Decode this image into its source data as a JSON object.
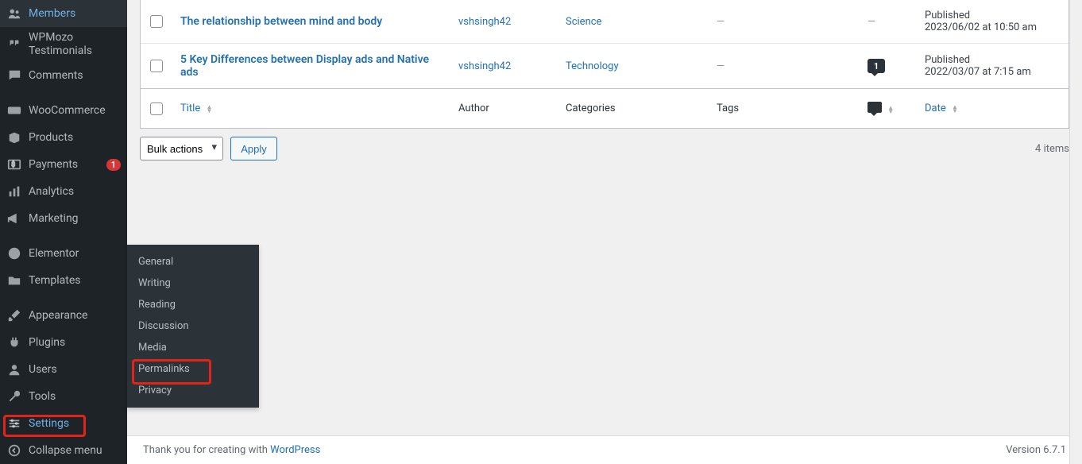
{
  "sidebar": {
    "items": [
      {
        "id": "members",
        "label": "Members"
      },
      {
        "id": "wpmozo",
        "label": "WPMozo Testimonials"
      },
      {
        "id": "comments",
        "label": "Comments"
      },
      {
        "id": "woocommerce",
        "label": "WooCommerce"
      },
      {
        "id": "products",
        "label": "Products"
      },
      {
        "id": "payments",
        "label": "Payments",
        "badge": "1"
      },
      {
        "id": "analytics",
        "label": "Analytics"
      },
      {
        "id": "marketing",
        "label": "Marketing"
      },
      {
        "id": "elementor",
        "label": "Elementor"
      },
      {
        "id": "templates",
        "label": "Templates"
      },
      {
        "id": "appearance",
        "label": "Appearance"
      },
      {
        "id": "plugins",
        "label": "Plugins"
      },
      {
        "id": "users",
        "label": "Users"
      },
      {
        "id": "tools",
        "label": "Tools"
      },
      {
        "id": "settings",
        "label": "Settings"
      },
      {
        "id": "collapse",
        "label": "Collapse menu"
      }
    ]
  },
  "submenu": {
    "items": [
      {
        "label": "General"
      },
      {
        "label": "Writing"
      },
      {
        "label": "Reading"
      },
      {
        "label": "Discussion"
      },
      {
        "label": "Media"
      },
      {
        "label": "Permalinks"
      },
      {
        "label": "Privacy"
      }
    ]
  },
  "table": {
    "columns": {
      "title": "Title",
      "author": "Author",
      "categories": "Categories",
      "tags": "Tags",
      "date": "Date"
    },
    "rows": [
      {
        "title": "The relationship between mind and body",
        "author": "vshsingh42",
        "category": "Science",
        "tags": "—",
        "comments": "—",
        "status": "Published",
        "date": "2023/06/02 at 10:50 am"
      },
      {
        "title": "5 Key Differences between Display ads and Native ads",
        "author": "vshsingh42",
        "category": "Technology",
        "tags": "—",
        "comments": "1",
        "status": "Published",
        "date": "2022/03/07 at 7:15 am"
      }
    ]
  },
  "bulk": {
    "label": "Bulk actions",
    "apply": "Apply"
  },
  "count_label": "4 items",
  "footer": {
    "thankyou_prefix": "Thank you for creating with ",
    "wp": "WordPress",
    "version": "Version 6.7.1"
  }
}
